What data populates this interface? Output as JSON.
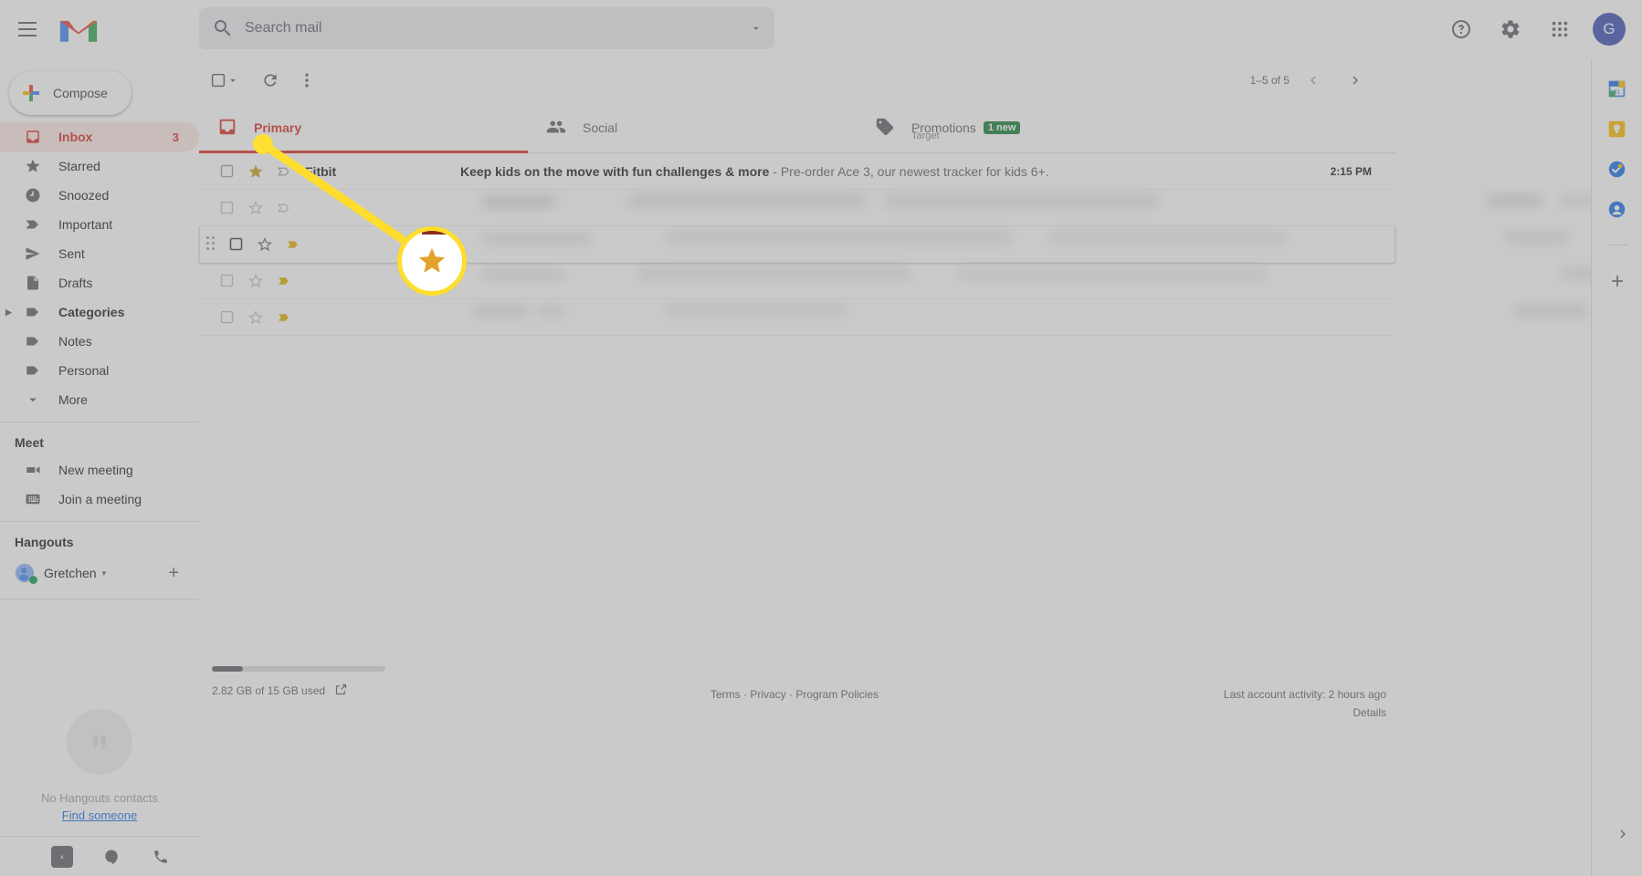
{
  "app": {
    "brand": "Gmail",
    "accent_red": "#d93025",
    "highlight_yellow": "#ffdd2d"
  },
  "header": {
    "menu_label": "Main menu",
    "logo_name": "gmail-logo",
    "search": {
      "placeholder": "Search mail",
      "value": "",
      "options_label": "Show search options"
    },
    "support_label": "Support",
    "settings_label": "Settings",
    "apps_label": "Google apps",
    "avatar_initial": "G"
  },
  "sidebar": {
    "compose_label": "Compose",
    "items": [
      {
        "label": "Inbox",
        "icon": "inbox-icon",
        "count": "3",
        "active": true
      },
      {
        "label": "Starred",
        "icon": "star-icon",
        "count": ""
      },
      {
        "label": "Snoozed",
        "icon": "clock-icon",
        "count": ""
      },
      {
        "label": "Important",
        "icon": "important-icon",
        "count": ""
      },
      {
        "label": "Sent",
        "icon": "send-icon",
        "count": ""
      },
      {
        "label": "Drafts",
        "icon": "draft-icon",
        "count": ""
      },
      {
        "label": "Categories",
        "icon": "label-icon",
        "count": "",
        "bold": true,
        "expandable": true
      },
      {
        "label": "Notes",
        "icon": "label-icon",
        "count": ""
      },
      {
        "label": "Personal",
        "icon": "label-icon",
        "count": ""
      },
      {
        "label": "More",
        "icon": "chevron-down-icon",
        "count": ""
      }
    ],
    "meet": {
      "title": "Meet",
      "items": [
        {
          "label": "New meeting",
          "icon": "video-camera-icon"
        },
        {
          "label": "Join a meeting",
          "icon": "keyboard-icon"
        }
      ]
    },
    "hangouts": {
      "title": "Hangouts",
      "user": "Gretchen",
      "add_label": "+",
      "empty_text": "No Hangouts contacts",
      "find_link": "Find someone"
    }
  },
  "toolbar": {
    "select_all_label": "Select",
    "refresh_label": "Refresh",
    "more_label": "More",
    "pager_range": "1–5 of 5",
    "prev_label": "Newer",
    "next_label": "Older"
  },
  "tabs": [
    {
      "label": "Primary",
      "icon": "inbox-tab-icon",
      "active": true,
      "sub": "",
      "badge": ""
    },
    {
      "label": "Social",
      "icon": "people-icon",
      "active": false,
      "sub": "",
      "badge": ""
    },
    {
      "label": "Promotions",
      "icon": "tag-icon",
      "active": false,
      "sub": "Target",
      "badge": "1 new"
    }
  ],
  "emails": [
    {
      "sender": "Fitbit",
      "subject": "Keep kids on the move with fun challenges & more",
      "snippet": " - Pre-order Ace 3, our newest tracker for kids 6+.",
      "time": "2:15 PM",
      "starred": true,
      "blurred": false
    },
    {
      "sender": "",
      "subject": "",
      "snippet": "",
      "time": "",
      "starred": false,
      "blurred": true
    },
    {
      "sender": "",
      "subject": "",
      "snippet": "",
      "time": "",
      "starred": false,
      "blurred": true,
      "hovered": true
    },
    {
      "sender": "",
      "subject": "",
      "snippet": "",
      "time": "",
      "starred": false,
      "blurred": true
    },
    {
      "sender": "",
      "subject": "",
      "snippet": "",
      "time": "",
      "starred": false,
      "blurred": true
    }
  ],
  "footer": {
    "storage_text": "2.82 GB of 15 GB used",
    "storage_percent": 18,
    "manage_label": "Manage storage",
    "links": "Terms · Privacy · Program Policies",
    "activity": "Last account activity: 2 hours ago",
    "details": "Details"
  },
  "right_panel": {
    "items": [
      {
        "name": "google-calendar-icon",
        "label": "Calendar"
      },
      {
        "name": "google-keep-icon",
        "label": "Keep"
      },
      {
        "name": "google-tasks-icon",
        "label": "Tasks"
      },
      {
        "name": "google-contacts-icon",
        "label": "Contacts"
      }
    ],
    "add_label": "+",
    "expand_label": "Show side panel"
  },
  "callout": {
    "target": "star-icon",
    "description": "Star icon on the first email row is highlighted and magnified"
  }
}
